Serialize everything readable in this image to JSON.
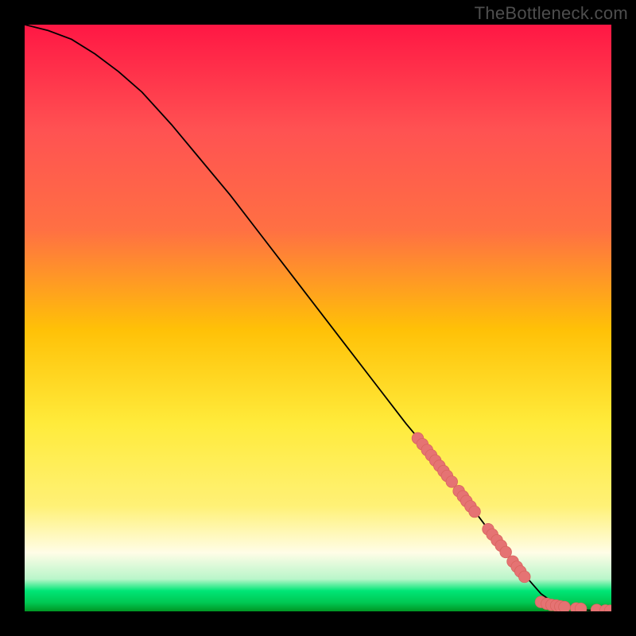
{
  "watermark": "TheBottleneck.com",
  "colors": {
    "bg_black": "#000000",
    "marker_fill": "#e57373",
    "curve": "#000000",
    "gradient_top": "#ff1744",
    "gradient_mid1": "#ff7043",
    "gradient_mid2": "#ffc107",
    "gradient_mid3": "#ffee58",
    "gradient_mid4": "#fff176",
    "gradient_pale": "#fffde7",
    "gradient_green1": "#00e676",
    "gradient_green2": "#00c853"
  },
  "chart_data": {
    "type": "line",
    "title": "",
    "xlabel": "",
    "ylabel": "",
    "xlim": [
      0,
      100
    ],
    "ylim": [
      0,
      100
    ],
    "grid": false,
    "legend": "none",
    "series": [
      {
        "name": "curve",
        "kind": "line",
        "x": [
          0,
          4,
          8,
          12,
          16,
          20,
          25,
          30,
          35,
          40,
          45,
          50,
          55,
          60,
          65,
          67.5,
          70,
          73,
          76,
          79,
          82,
          84.5,
          88,
          90,
          92,
          94,
          96,
          100
        ],
        "y": [
          100,
          99,
          97.5,
          95,
          92,
          88.5,
          83,
          77,
          71,
          64.5,
          58,
          51.5,
          45,
          38.5,
          32,
          29,
          25.5,
          22,
          18,
          14,
          10,
          7,
          3,
          1.6,
          0.9,
          0.45,
          0.2,
          0
        ]
      },
      {
        "name": "highlight-markers-diagonal",
        "kind": "scatter",
        "x": [
          67.0,
          67.8,
          68.6,
          69.3,
          70.0,
          70.7,
          71.4,
          72.0,
          72.8,
          74.0,
          74.7,
          75.3,
          76.0,
          76.7,
          79.0,
          79.7,
          80.5,
          81.2,
          82.0,
          83.2,
          83.9,
          84.5,
          85.2
        ],
        "y": [
          29.5,
          28.5,
          27.5,
          26.6,
          25.7,
          24.8,
          23.9,
          23.1,
          22.1,
          20.5,
          19.6,
          18.8,
          17.9,
          17.0,
          14.0,
          13.1,
          12.1,
          11.2,
          10.1,
          8.5,
          7.6,
          6.8,
          5.9
        ]
      },
      {
        "name": "highlight-markers-bottom",
        "kind": "scatter",
        "x": [
          88.0,
          89.0,
          89.8,
          90.6,
          91.3,
          92.0,
          94.0,
          94.8,
          97.5,
          99.0,
          99.8
        ],
        "y": [
          1.6,
          1.3,
          1.1,
          1.0,
          0.85,
          0.75,
          0.5,
          0.45,
          0.25,
          0.15,
          0.1
        ]
      }
    ]
  }
}
